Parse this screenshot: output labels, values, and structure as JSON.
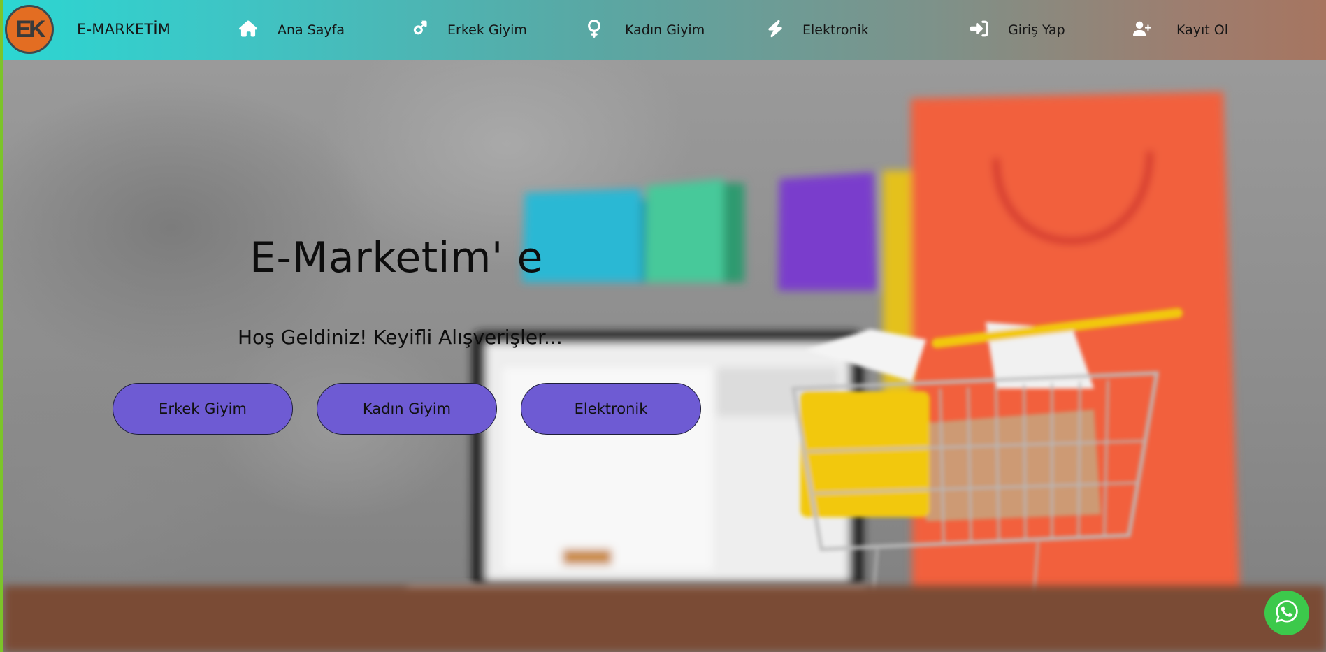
{
  "brand": {
    "logo_text": "EK",
    "name": "E-MARKETİM"
  },
  "nav": {
    "items": [
      {
        "label": "Ana Sayfa",
        "icon": "home-icon"
      },
      {
        "label": "Erkek Giyim",
        "icon": "mars-icon"
      },
      {
        "label": "Kadın Giyim",
        "icon": "venus-icon"
      },
      {
        "label": "Elektronik",
        "icon": "bolt-icon"
      },
      {
        "label": "Giriş Yap",
        "icon": "sign-in-icon"
      },
      {
        "label": "Kayıt Ol",
        "icon": "user-plus-icon"
      }
    ]
  },
  "hero": {
    "title": "E-Marketim' e",
    "subtitle": "Hoş Geldiniz! Keyifli Alışverişler...",
    "buttons": [
      {
        "label": "Erkek Giyim"
      },
      {
        "label": "Kadın Giyim"
      },
      {
        "label": "Elektronik"
      }
    ]
  },
  "floating": {
    "whatsapp_icon": "whatsapp-icon"
  },
  "colors": {
    "nav_gradient_start": "#2cd6d2",
    "nav_gradient_end": "#a67560",
    "logo_bg": "#e36d22",
    "button_bg": "#6e5bd3",
    "whatsapp_bg": "#3cc94b"
  }
}
